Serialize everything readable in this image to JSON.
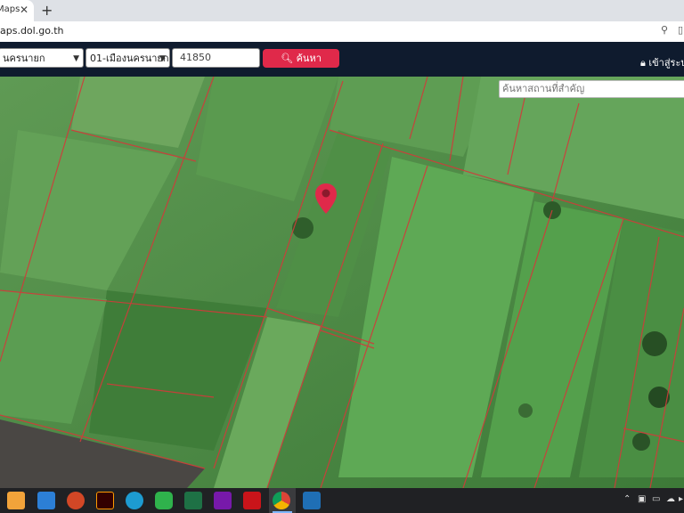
{
  "browser": {
    "tab_title": "Maps",
    "tab_close": "✕",
    "new_tab": "+",
    "url": "aps.dol.go.th"
  },
  "header": {
    "province_value": "นครนายก",
    "district_value": "01-เมืองนครนายก",
    "zip_value": "41850",
    "search_button": "ค้นหา",
    "login_label": "เข้าสู่ระบบ"
  },
  "map": {
    "place_search_placeholder": "ค้นหาสถานที่สำคัญ",
    "parcel_line_color": "#d23a3a",
    "marker_color": "#e0294a"
  },
  "taskbar": {
    "apps": [
      "store-icon",
      "mail-icon",
      "powerpoint-icon",
      "illustrator-icon",
      "edge-icon",
      "line-icon",
      "excel-icon",
      "onenote-icon",
      "acrobat-icon",
      "chrome-icon",
      "photos-icon"
    ]
  }
}
